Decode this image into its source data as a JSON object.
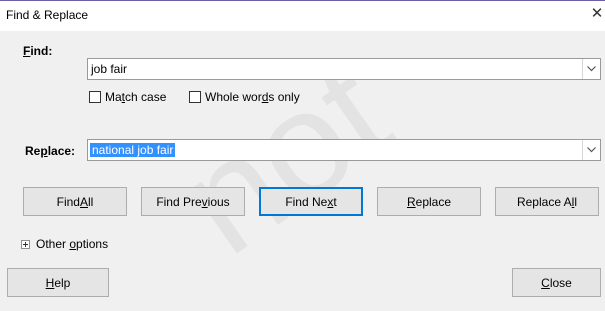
{
  "window": {
    "title": "Find & Replace",
    "close_glyph": "✕"
  },
  "find": {
    "label_pre": "",
    "label_key": "F",
    "label_post": "ind:",
    "value": "job fair"
  },
  "options": {
    "match_case": {
      "pre": "Ma",
      "key": "t",
      "post": "ch case",
      "checked": false
    },
    "whole_words": {
      "pre": "Whole wor",
      "key": "d",
      "post": "s only",
      "checked": false
    }
  },
  "replace": {
    "label_pre": "Re",
    "label_key": "p",
    "label_post": "lace:",
    "value": "national job fair"
  },
  "buttons": {
    "find_all": {
      "pre": "Find ",
      "key": "A",
      "post": "ll"
    },
    "find_previous": {
      "pre": "Find Pre",
      "key": "v",
      "post": "ious"
    },
    "find_next": {
      "pre": "Find Ne",
      "key": "x",
      "post": "t"
    },
    "replace": {
      "pre": "",
      "key": "R",
      "post": "eplace"
    },
    "replace_all": {
      "pre": "Replace A",
      "key": "l",
      "post": "l"
    },
    "help": {
      "pre": "",
      "key": "H",
      "post": "elp"
    },
    "close": {
      "pre": "",
      "key": "C",
      "post": "lose"
    }
  },
  "other_options": {
    "pre": "Other ",
    "key": "o",
    "post": "ptions"
  },
  "colors": {
    "selection": "#3390ff",
    "default_button_border": "#0078d7"
  }
}
